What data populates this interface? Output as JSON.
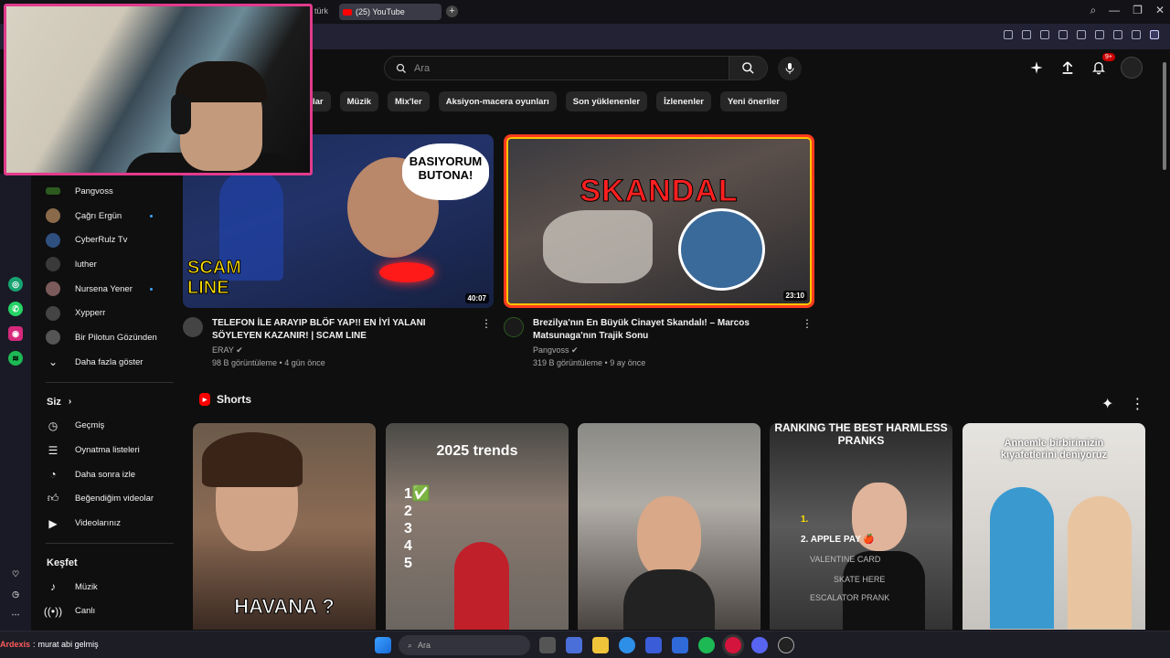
{
  "browser": {
    "prev_tab": "türk",
    "active_tab": "(25) YouTube",
    "new_tab": "+",
    "window_controls": [
      "⌕",
      "—",
      "❐",
      "✕"
    ]
  },
  "search": {
    "placeholder": "Ara"
  },
  "notifications_badge": "9+",
  "chips": [
    "lar",
    "Müzik",
    "Mix'ler",
    "Aksiyon-macera oyunları",
    "Son yüklenenler",
    "İzlenenler",
    "Yeni öneriler"
  ],
  "sidebar": {
    "subscriptions": [
      {
        "label": "Pangvoss",
        "color": "#2d5a1f",
        "dot": false
      },
      {
        "label": "Çağrı Ergün",
        "color": "#8a6a4a",
        "dot": true
      },
      {
        "label": "CyberRulz Tv",
        "color": "#2f4f7f",
        "dot": false
      },
      {
        "label": "luther",
        "color": "#3a3a3a",
        "dot": false
      },
      {
        "label": "Nursena Yener",
        "color": "#7a5a5a",
        "dot": true
      },
      {
        "label": "Xypperr",
        "color": "#444",
        "dot": false
      },
      {
        "label": "Bir Pilotun Gözünden",
        "color": "#555",
        "dot": false
      }
    ],
    "show_more": "Daha fazla göster",
    "you_heading": "Siz",
    "you_items": [
      "Geçmiş",
      "Oynatma listeleri",
      "Daha sonra izle",
      "Beğendiğim videolar",
      "Videolarınız"
    ],
    "explore_heading": "Keşfet",
    "explore_items": [
      "Müzik",
      "Canlı"
    ]
  },
  "videos": [
    {
      "title": "TELEFON İLE ARAYIP BLÖF YAP!! EN İYİ YALANI SÖYLEYEN KAZANIR! | SCAM LINE",
      "channel": "ERAY",
      "stats": "98 B görüntüleme • 4 gün önce",
      "duration": "40:07",
      "thumb_text_1": "BASIYORUM BUTONA!",
      "thumb_text_2": "SCAM LINE"
    },
    {
      "title": "Brezilya'nın En Büyük Cinayet Skandalı! – Marcos Matsunaga'nın Trajik Sonu",
      "channel": "Pangvoss",
      "stats": "319 B görüntüleme • 9 ay önce",
      "duration": "23:10",
      "thumb_text_1": "SKANDAL"
    }
  ],
  "shorts": {
    "heading": "Shorts",
    "items": [
      {
        "caption": "HAVANA ?"
      },
      {
        "caption": "2025 trends",
        "list": [
          "1✅",
          "2",
          "3",
          "4",
          "5"
        ]
      },
      {
        "caption": ""
      },
      {
        "caption": "RANKING THE BEST HARMLESS PRANKS",
        "sub": "1.",
        "sub2": "2. APPLE PAY 🍎",
        "sub3": "VALENTINE CARD",
        "sub4": "SKATE HERE",
        "sub5": "ESCALATOR PRANK"
      },
      {
        "caption": "Annemle birbirimizin kıyafetlerini deniyoruz"
      }
    ]
  },
  "taskbar": {
    "search_placeholder": "Ara",
    "chat_user": "Ardexis",
    "chat_message": "murat abi gelmiş"
  },
  "colors": {
    "accent": "#ff0000",
    "webcam_border": "#e23b8c",
    "thumb_border": "#ff3b1f"
  }
}
